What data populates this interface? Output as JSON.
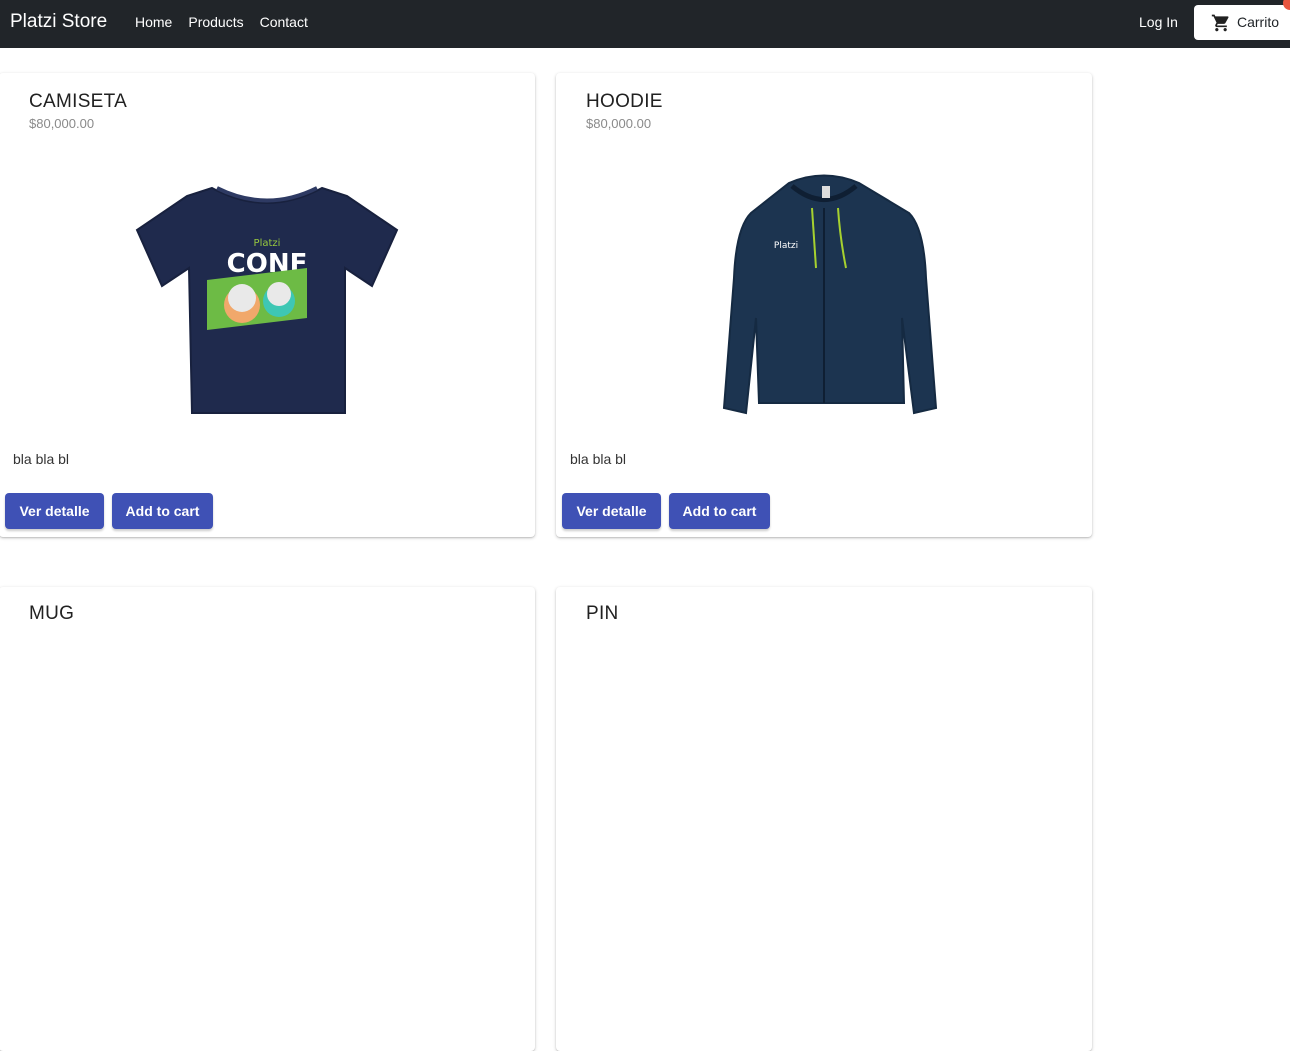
{
  "navbar": {
    "brand": "Platzi Store",
    "links": [
      "Home",
      "Products",
      "Contact"
    ],
    "login_label": "Log In",
    "cart_label": "Carrito",
    "cart_icon": "shopping-cart-icon",
    "bg_color": "#212529",
    "badge_color": "#e8553f"
  },
  "products": [
    {
      "name": "CAMISETA",
      "price": "$80,000.00",
      "image": "tshirt-image",
      "description": "bla bla bl",
      "detail_label": "Ver detalle",
      "cart_label": "Add to cart"
    },
    {
      "name": "HOODIE",
      "price": "$80,000.00",
      "image": "hoodie-image",
      "description": "bla bla bl",
      "detail_label": "Ver detalle",
      "cart_label": "Add to cart"
    },
    {
      "name": "MUG"
    },
    {
      "name": "PIN"
    }
  ],
  "accent_color": "#3f51b5"
}
